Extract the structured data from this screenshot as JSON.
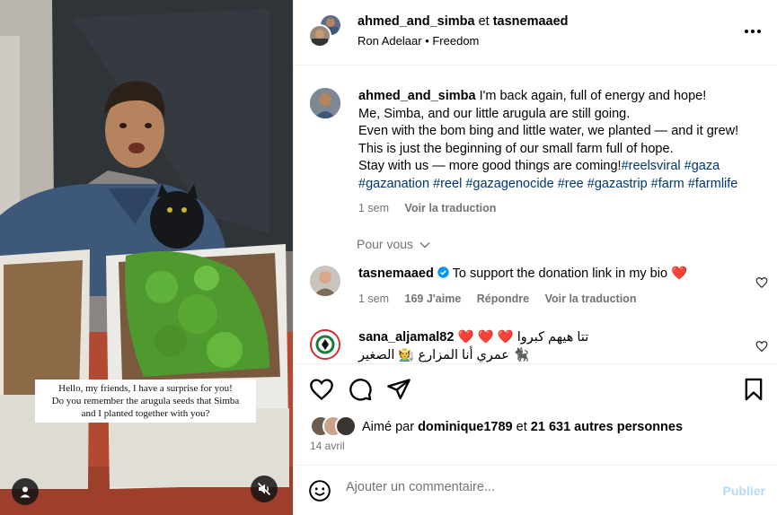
{
  "media": {
    "caption_lines": [
      "Hello, my friends, I have a surprise for you!",
      "Do you remember the arugula seeds that Simba",
      "and I planted together with you?"
    ],
    "user_icon": "user-icon",
    "mute_icon": "muted-speaker-icon"
  },
  "header": {
    "author": "ahmed_and_simba",
    "conjunction": "et",
    "coauthor": "tasnemaaed",
    "audio_artist": "Ron Adelaar",
    "audio_track": "Freedom",
    "more_icon": "more-horizontal-icon"
  },
  "post": {
    "username": "ahmed_and_simba",
    "line1": "I'm back again, full of energy and hope!",
    "line2": "Me, Simba, and our little arugula are still going.",
    "line3": "Even with the bom bing and little water, we planted — and it grew!",
    "line4": "This is just the beginning of our small farm full of hope.",
    "line5": "Stay with us — more good things are coming!",
    "hashtags_line5": "#reelsviral #gaza",
    "hashtags_line6": "#gazanation #reel #gazagenocide #ree #gazastrip #farm #farmlife",
    "time": "1 sem",
    "translate": "Voir la traduction"
  },
  "for_you": "Pour vous",
  "comments": [
    {
      "username": "tasnemaaed",
      "verified": true,
      "text": "To support the donation link in my bio ❤️",
      "time": "1 sem",
      "likes": "169 J'aime",
      "reply": "Répondre",
      "translate": "Voir la traduction"
    },
    {
      "username": "sana_aljamal82",
      "text": "❤️ ❤️ ❤️ تتا هيهم كبروا",
      "text2": "🐈‍⬛ عمري أنا المزارع 🧑‍🌾 الصغير وسيمبا"
    }
  ],
  "actions": {
    "like_icon": "heart-icon",
    "comment_icon": "comment-icon",
    "share_icon": "share-icon",
    "save_icon": "bookmark-icon"
  },
  "likes": {
    "prefix": "Aimé par",
    "user": "dominique1789",
    "middle": "et",
    "count": "21 631 autres personnes"
  },
  "date": "14 avril",
  "composer": {
    "placeholder": "Ajouter un commentaire...",
    "publish": "Publier",
    "emoji_icon": "emoji-icon"
  },
  "colors": {
    "hashtag": "#00376b",
    "muted": "#737373",
    "verified": "#0095f6",
    "publish_disabled": "#b3dbff",
    "heart_red": "#ed1c24"
  }
}
